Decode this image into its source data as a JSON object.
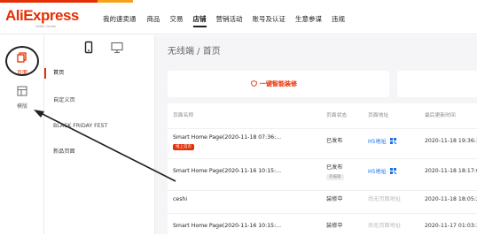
{
  "colors": {
    "brand": "#e62e04",
    "link": "#1a6fe6",
    "muted": "#bbbbbb"
  },
  "header": {
    "logo": "AliExpress",
    "logo_sub": "Seller Center",
    "nav": [
      "我的速卖通",
      "商品",
      "交易",
      "店铺",
      "营销活动",
      "账号及认证",
      "生意参谋",
      "违规"
    ],
    "active_nav": "店铺"
  },
  "left_rail": [
    {
      "label": "页面",
      "icon": "page-copy-icon",
      "active": true
    },
    {
      "label": "模版",
      "icon": "template-icon",
      "active": false
    }
  ],
  "secondary": {
    "tabs": [
      {
        "icon": "mobile-icon",
        "active": true
      },
      {
        "icon": "desktop-icon",
        "active": false
      }
    ],
    "items": [
      "首页",
      "自定义页",
      "BLACK FRIDAY FEST",
      "新品页面"
    ]
  },
  "main": {
    "title": "无线端 / 首页",
    "smart_button": "一键智能装修",
    "columns": [
      "页面名称",
      "页面状态",
      "页面地址",
      "最后更新时间"
    ],
    "rows": [
      {
        "name": "Smart Home Page(2020-11-18 07:36:...",
        "tag": "线上首页",
        "status": "已发布",
        "status_tag": "",
        "address": "H5地址",
        "time": "2020-11-18 19:36:3"
      },
      {
        "name": "Smart Home Page(2020-11-16 10:15:...",
        "tag": "",
        "status": "已发布",
        "status_tag": "有编辑",
        "address": "H5地址",
        "time": "2020-11-18 18:17:0"
      },
      {
        "name": "ceshi",
        "tag": "",
        "status": "装修中",
        "status_tag": "",
        "address": "尚无页面地址",
        "time": "2020-11-18 18:05:2"
      },
      {
        "name": "Smart Home Page(2020-11-16 10:15:...",
        "tag": "",
        "status": "装修中",
        "status_tag": "",
        "address": "尚无页面地址",
        "time": "2020-11-17 01:03:3"
      }
    ]
  }
}
